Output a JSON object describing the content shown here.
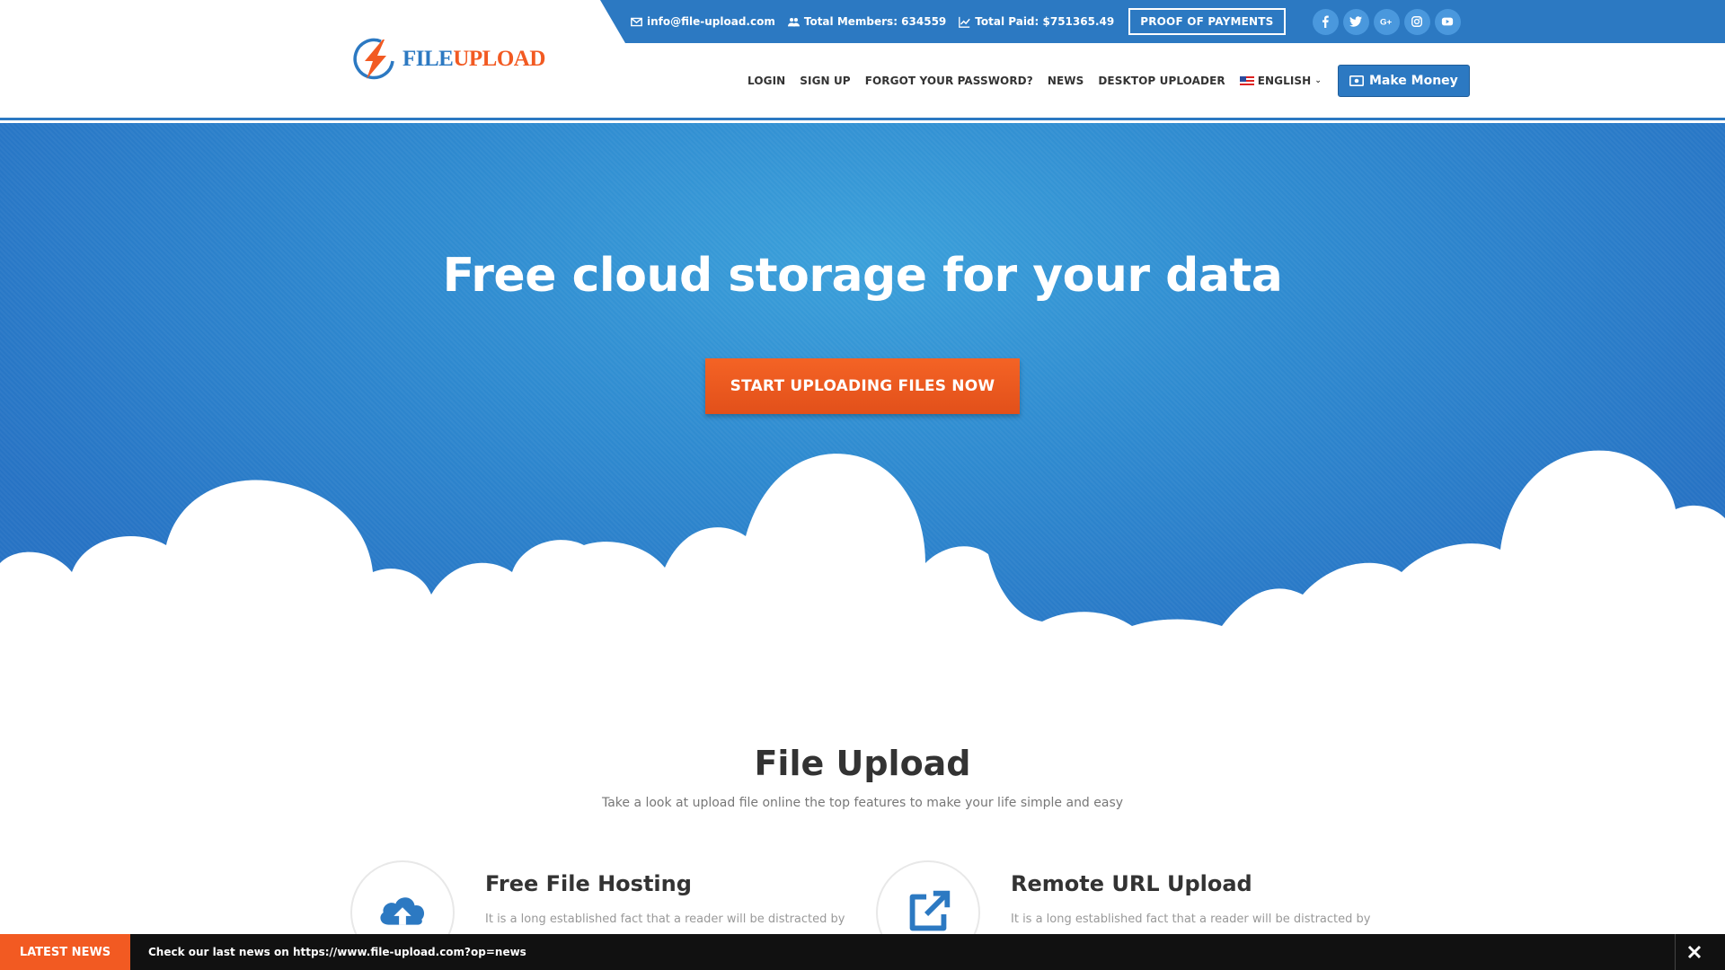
{
  "topbar": {
    "email": "info@file-upload.com",
    "members": "Total Members: 634559",
    "paid": "Total Paid: $751365.49",
    "proof_button": "PROOF OF PAYMENTS",
    "socials": [
      "facebook-icon",
      "twitter-icon",
      "google-plus-icon",
      "instagram-icon",
      "youtube-icon"
    ]
  },
  "header": {
    "logo_file": "FILE",
    "logo_upload": "UPLOAD",
    "nav": {
      "login": "LOGIN",
      "signup": "SIGN UP",
      "forgot": "FORGOT YOUR PASSWORD?",
      "news": "NEWS",
      "desktop": "DESKTOP UPLOADER",
      "language": "ENGLISH"
    },
    "make_money": "Make Money"
  },
  "hero": {
    "title": "Free cloud storage for your data",
    "cta": "START UPLOADING FILES NOW"
  },
  "features": {
    "title": "File Upload",
    "subtitle": "Take a look at upload file online the top features to make your life simple and easy",
    "items": [
      {
        "icon": "cloud-upload-icon",
        "title": "Free File Hosting",
        "text": "It is a long established fact that a reader will be distracted by"
      },
      {
        "icon": "external-link-icon",
        "title": "Remote URL Upload",
        "text": "It is a long established fact that a reader will be distracted by"
      }
    ]
  },
  "newsbar": {
    "label": "LATEST NEWS",
    "text": "Check our last news on https://www.file-upload.com?op=news"
  },
  "colors": {
    "brand_blue": "#2c79c2",
    "accent_orange": "#f25a22"
  }
}
